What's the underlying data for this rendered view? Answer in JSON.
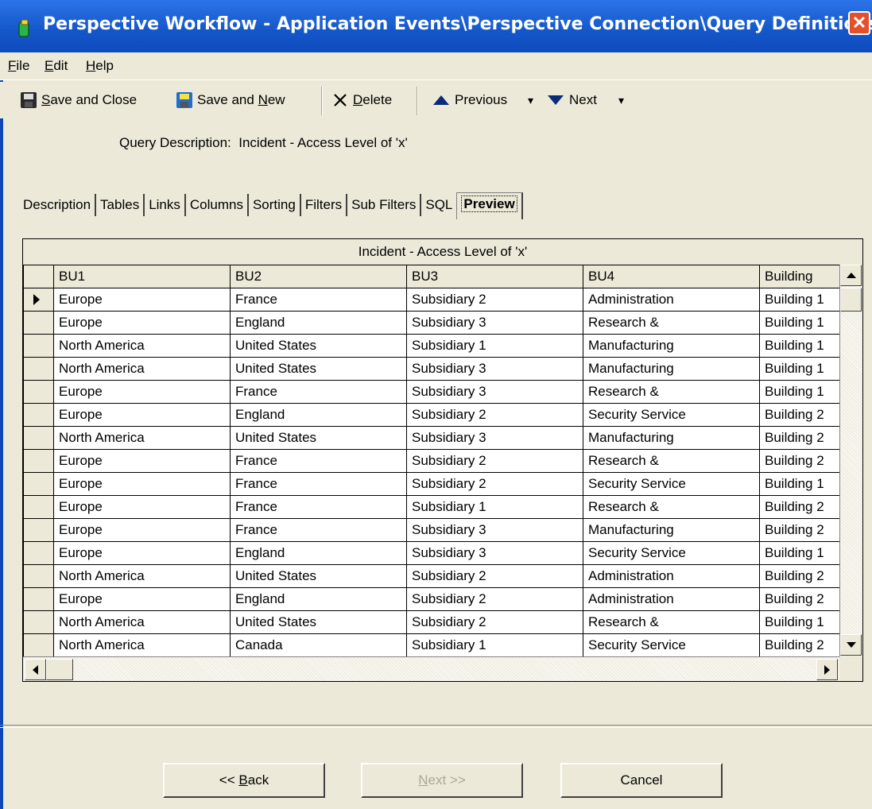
{
  "window": {
    "title": "Perspective Workflow - Application Events\\Perspective Connection\\Query Definitions",
    "close_glyph": "✕"
  },
  "menu": [
    {
      "label": "File",
      "underline": "F",
      "rest": "ile"
    },
    {
      "label": "Edit",
      "underline": "E",
      "rest": "dit"
    },
    {
      "label": "Help",
      "underline": "H",
      "rest": "elp"
    }
  ],
  "toolbar": {
    "save_close": {
      "pre": "",
      "u": "S",
      "post": "ave and Close",
      "icon": "floppy-disk-icon"
    },
    "save_new": {
      "pre": "Save and ",
      "u": "N",
      "post": "ew",
      "icon": "floppy-disk-new-icon"
    },
    "delete": {
      "pre": "",
      "u": "D",
      "post": "elete",
      "icon": "delete-x-icon"
    },
    "previous": {
      "label": "Previous",
      "icon": "arrow-up-icon"
    },
    "next": {
      "label": "Next",
      "icon": "arrow-down-icon"
    },
    "dropdown_glyph": "▾"
  },
  "query_description": {
    "label": "Query Description:",
    "value": "Incident - Access Level of 'x'"
  },
  "tabs": [
    {
      "label": "Description",
      "active": false
    },
    {
      "label": "Tables",
      "active": false
    },
    {
      "label": "Links",
      "active": false
    },
    {
      "label": "Columns",
      "active": false
    },
    {
      "label": "Sorting",
      "active": false
    },
    {
      "label": "Filters",
      "active": false
    },
    {
      "label": "Sub Filters",
      "active": false
    },
    {
      "label": "SQL",
      "active": false
    },
    {
      "label": "Preview",
      "active": true
    }
  ],
  "grid": {
    "caption": "Incident - Access Level of 'x'",
    "columns": [
      "BU1",
      "BU2",
      "BU3",
      "BU4",
      "Building"
    ],
    "selected_row": 0,
    "rows": [
      [
        "Europe",
        "France",
        "Subsidiary 2",
        "Administration",
        "Building 1"
      ],
      [
        "Europe",
        "England",
        "Subsidiary 3",
        "Research &",
        "Building 1"
      ],
      [
        "North America",
        "United States",
        "Subsidiary 1",
        "Manufacturing",
        "Building 1"
      ],
      [
        "North America",
        "United States",
        "Subsidiary 3",
        "Manufacturing",
        "Building 1"
      ],
      [
        "Europe",
        "France",
        "Subsidiary 3",
        "Research &",
        "Building 1"
      ],
      [
        "Europe",
        "England",
        "Subsidiary 2",
        "Security Service",
        "Building 2"
      ],
      [
        "North America",
        "United States",
        "Subsidiary 3",
        "Manufacturing",
        "Building 2"
      ],
      [
        "Europe",
        "France",
        "Subsidiary 2",
        "Research &",
        "Building 2"
      ],
      [
        "Europe",
        "France",
        "Subsidiary 2",
        "Security Service",
        "Building 1"
      ],
      [
        "Europe",
        "France",
        "Subsidiary 1",
        "Research &",
        "Building 2"
      ],
      [
        "Europe",
        "France",
        "Subsidiary 3",
        "Manufacturing",
        "Building 2"
      ],
      [
        "Europe",
        "England",
        "Subsidiary 3",
        "Security Service",
        "Building 1"
      ],
      [
        "North America",
        "United States",
        "Subsidiary 2",
        "Administration",
        "Building 2"
      ],
      [
        "Europe",
        "England",
        "Subsidiary 2",
        "Administration",
        "Building 2"
      ],
      [
        "North America",
        "United States",
        "Subsidiary 2",
        "Research &",
        "Building 1"
      ],
      [
        "North America",
        "Canada",
        "Subsidiary 1",
        "Security Service",
        "Building 2"
      ]
    ]
  },
  "buttons": {
    "back": {
      "pre": "<< ",
      "u": "B",
      "post": "ack",
      "enabled": true
    },
    "next": {
      "pre": "",
      "u": "N",
      "post": "ext >>",
      "enabled": false
    },
    "cancel": {
      "label": "Cancel",
      "enabled": true
    }
  }
}
